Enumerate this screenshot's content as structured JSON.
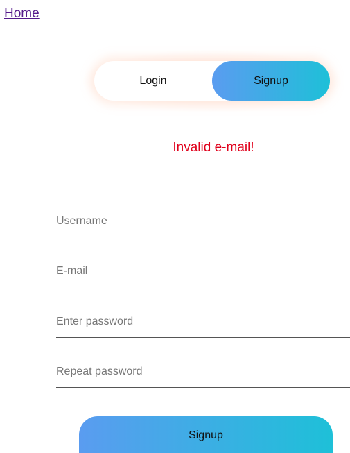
{
  "nav": {
    "home_label": "Home"
  },
  "toggle": {
    "login_label": "Login",
    "signup_label": "Signup",
    "active": "Signup"
  },
  "error": {
    "message": "Invalid e-mail!",
    "color": "#e0001b"
  },
  "form": {
    "username_placeholder": "Username",
    "email_placeholder": "E-mail",
    "password_placeholder": "Enter password",
    "repeat_password_placeholder": "Repeat password",
    "submit_label": "Signup"
  },
  "colors": {
    "gradient_start": "#5a9cf0",
    "gradient_end": "#1ec0d8",
    "link": "#551a8b"
  }
}
